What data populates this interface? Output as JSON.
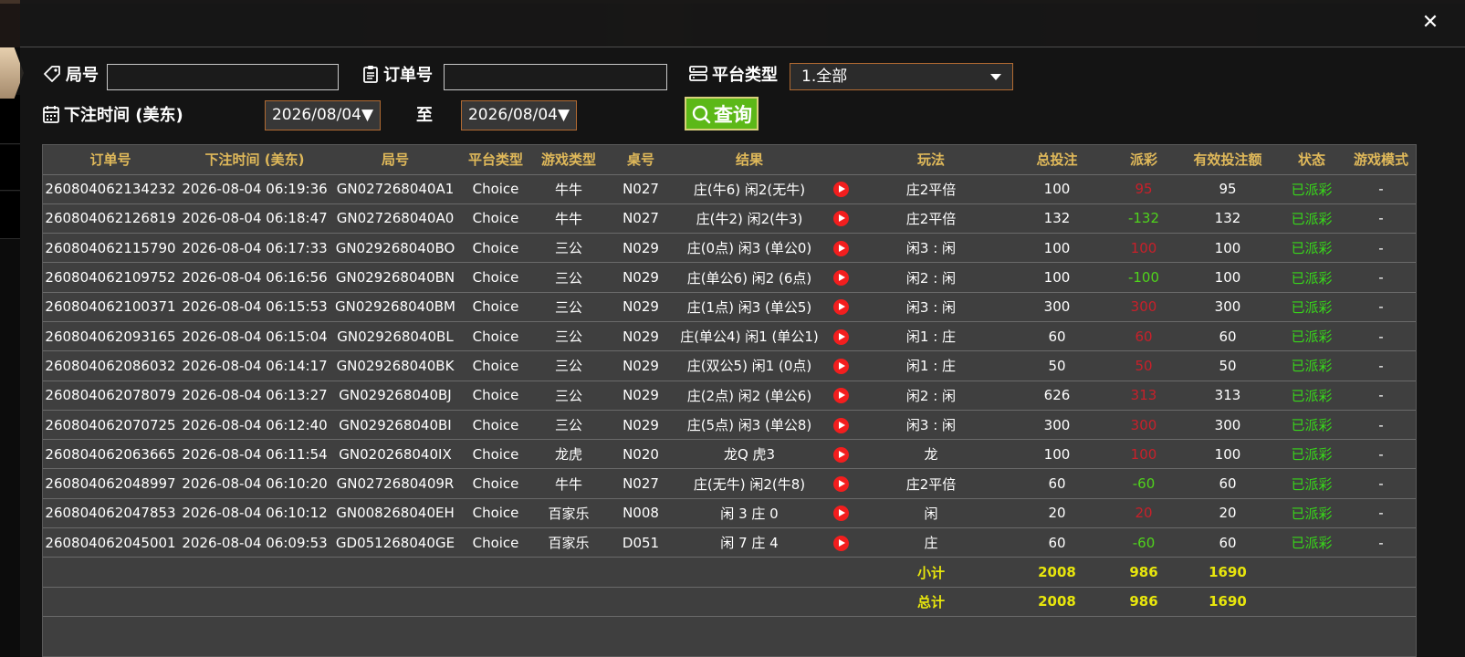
{
  "filters": {
    "round_label": "局号",
    "order_label": "订单号",
    "platform_label": "平台类型",
    "platform_value": "1.全部",
    "time_label": "下注时间 (美东)",
    "date_from": "2026/08/04▼",
    "to_label": "至",
    "date_to": "2026/08/04▼",
    "query_label": "查询"
  },
  "table": {
    "headers": [
      "订单号",
      "下注时间 (美东)",
      "局号",
      "平台类型",
      "游戏类型",
      "桌号",
      "结果",
      "",
      "玩法",
      "总投注",
      "派彩",
      "有效投注额",
      "状态",
      "游戏模式"
    ],
    "rows": [
      {
        "order": "260804062134232",
        "time": "2026-08-04 06:19:36",
        "round": "GN027268040A1",
        "platform": "Choice",
        "game": "牛牛",
        "table": "N027",
        "result": "庄(牛6) 闲2(无牛)",
        "play": "庄2平倍",
        "bet": "100",
        "payout": "95",
        "payout_sign": "pos",
        "valid": "95",
        "status": "已派彩",
        "mode": "-"
      },
      {
        "order": "260804062126819",
        "time": "2026-08-04 06:18:47",
        "round": "GN027268040A0",
        "platform": "Choice",
        "game": "牛牛",
        "table": "N027",
        "result": "庄(牛2) 闲2(牛3)",
        "play": "庄2平倍",
        "bet": "132",
        "payout": "-132",
        "payout_sign": "neg",
        "valid": "132",
        "status": "已派彩",
        "mode": "-"
      },
      {
        "order": "260804062115790",
        "time": "2026-08-04 06:17:33",
        "round": "GN029268040BO",
        "platform": "Choice",
        "game": "三公",
        "table": "N029",
        "result": "庄(0点) 闲3 (单公0)",
        "play": "闲3 : 闲",
        "bet": "100",
        "payout": "100",
        "payout_sign": "pos",
        "valid": "100",
        "status": "已派彩",
        "mode": "-"
      },
      {
        "order": "260804062109752",
        "time": "2026-08-04 06:16:56",
        "round": "GN029268040BN",
        "platform": "Choice",
        "game": "三公",
        "table": "N029",
        "result": "庄(单公6) 闲2 (6点)",
        "play": "闲2 : 闲",
        "bet": "100",
        "payout": "-100",
        "payout_sign": "neg",
        "valid": "100",
        "status": "已派彩",
        "mode": "-"
      },
      {
        "order": "260804062100371",
        "time": "2026-08-04 06:15:53",
        "round": "GN029268040BM",
        "platform": "Choice",
        "game": "三公",
        "table": "N029",
        "result": "庄(1点) 闲3 (单公5)",
        "play": "闲3 : 闲",
        "bet": "300",
        "payout": "300",
        "payout_sign": "pos",
        "valid": "300",
        "status": "已派彩",
        "mode": "-"
      },
      {
        "order": "260804062093165",
        "time": "2026-08-04 06:15:04",
        "round": "GN029268040BL",
        "platform": "Choice",
        "game": "三公",
        "table": "N029",
        "result": "庄(单公4) 闲1 (单公1)",
        "play": "闲1 : 庄",
        "bet": "60",
        "payout": "60",
        "payout_sign": "pos",
        "valid": "60",
        "status": "已派彩",
        "mode": "-"
      },
      {
        "order": "260804062086032",
        "time": "2026-08-04 06:14:17",
        "round": "GN029268040BK",
        "platform": "Choice",
        "game": "三公",
        "table": "N029",
        "result": "庄(双公5) 闲1 (0点)",
        "play": "闲1 : 庄",
        "bet": "50",
        "payout": "50",
        "payout_sign": "pos",
        "valid": "50",
        "status": "已派彩",
        "mode": "-"
      },
      {
        "order": "260804062078079",
        "time": "2026-08-04 06:13:27",
        "round": "GN029268040BJ",
        "platform": "Choice",
        "game": "三公",
        "table": "N029",
        "result": "庄(2点) 闲2 (单公6)",
        "play": "闲2 : 闲",
        "bet": "626",
        "payout": "313",
        "payout_sign": "pos",
        "valid": "313",
        "status": "已派彩",
        "mode": "-"
      },
      {
        "order": "260804062070725",
        "time": "2026-08-04 06:12:40",
        "round": "GN029268040BI",
        "platform": "Choice",
        "game": "三公",
        "table": "N029",
        "result": "庄(5点) 闲3 (单公8)",
        "play": "闲3 : 闲",
        "bet": "300",
        "payout": "300",
        "payout_sign": "pos",
        "valid": "300",
        "status": "已派彩",
        "mode": "-"
      },
      {
        "order": "260804062063665",
        "time": "2026-08-04 06:11:54",
        "round": "GN020268040IX",
        "platform": "Choice",
        "game": "龙虎",
        "table": "N020",
        "result": "龙Q 虎3",
        "play": "龙",
        "bet": "100",
        "payout": "100",
        "payout_sign": "pos",
        "valid": "100",
        "status": "已派彩",
        "mode": "-"
      },
      {
        "order": "260804062048997",
        "time": "2026-08-04 06:10:20",
        "round": "GN0272680409R",
        "platform": "Choice",
        "game": "牛牛",
        "table": "N027",
        "result": "庄(无牛) 闲2(牛8)",
        "play": "庄2平倍",
        "bet": "60",
        "payout": "-60",
        "payout_sign": "neg",
        "valid": "60",
        "status": "已派彩",
        "mode": "-"
      },
      {
        "order": "260804062047853",
        "time": "2026-08-04 06:10:12",
        "round": "GN008268040EH",
        "platform": "Choice",
        "game": "百家乐",
        "table": "N008",
        "result": "闲 3 庄 0",
        "play": "闲",
        "bet": "20",
        "payout": "20",
        "payout_sign": "pos",
        "valid": "20",
        "status": "已派彩",
        "mode": "-"
      },
      {
        "order": "260804062045001",
        "time": "2026-08-04 06:09:53",
        "round": "GD051268040GE",
        "platform": "Choice",
        "game": "百家乐",
        "table": "D051",
        "result": "闲 7 庄 4",
        "play": "庄",
        "bet": "60",
        "payout": "-60",
        "payout_sign": "neg",
        "valid": "60",
        "status": "已派彩",
        "mode": "-"
      }
    ],
    "subtotal": {
      "label": "小计",
      "bet": "2008",
      "payout": "986",
      "valid": "1690"
    },
    "total": {
      "label": "总计",
      "bet": "2008",
      "payout": "986",
      "valid": "1690"
    }
  },
  "icons": {
    "tag": "tag-icon",
    "clipboard": "clipboard-icon",
    "server": "server-icon",
    "calendar": "calendar-icon",
    "search": "search-icon",
    "play": "play-icon",
    "close": "close-icon"
  },
  "colors": {
    "header_text": "#e0b95a",
    "positive_payout": "#c8202a",
    "negative_payout": "#4fd31c",
    "status": "#38d61a",
    "totals": "#e8e60c",
    "query_button": "#5cb818",
    "play_button": "#f21e1e"
  }
}
